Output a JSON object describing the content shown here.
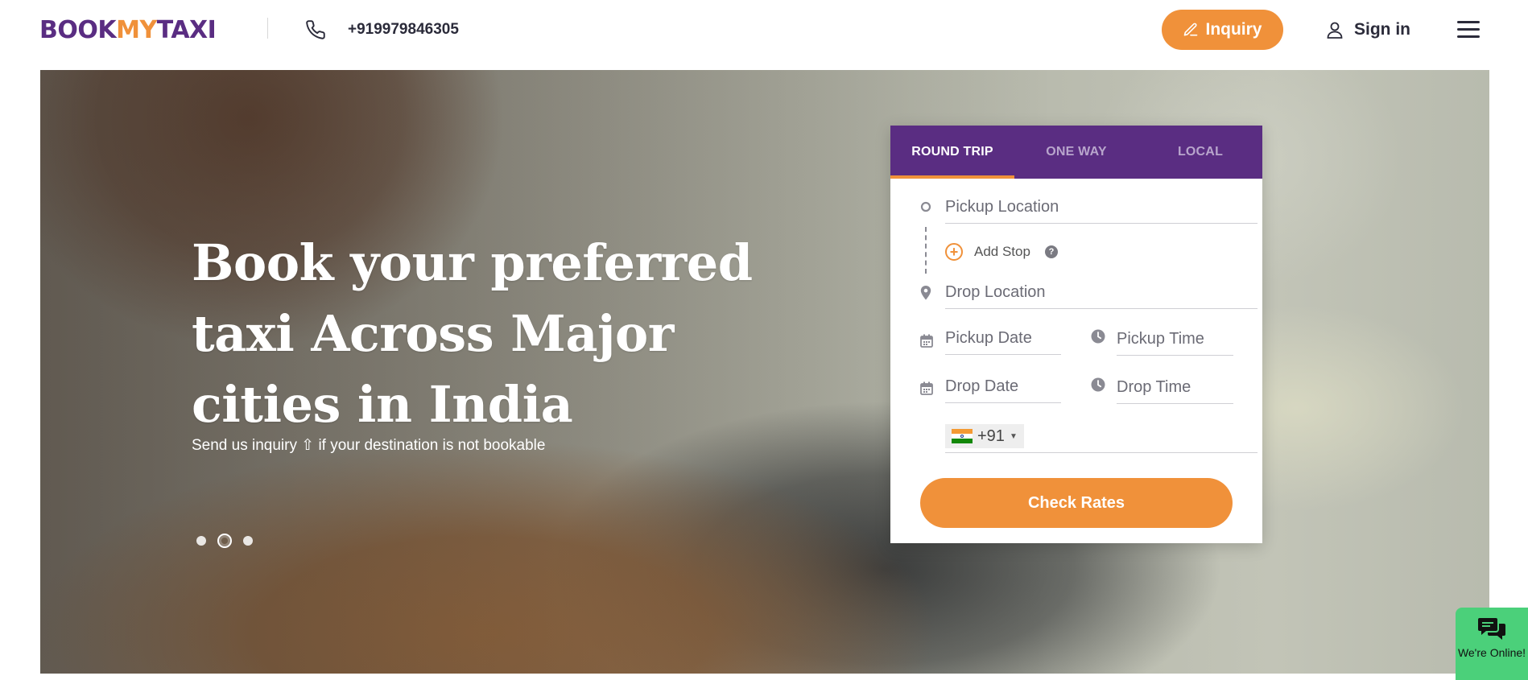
{
  "brand": {
    "part1": "BOOK",
    "part2": "MY",
    "part3": "TAXI",
    "purple": "#5a2d82",
    "orange": "#f0913a"
  },
  "header": {
    "phone_icon": "phone-icon",
    "phone_number": "+919979846305",
    "inquiry_label": "Inquiry",
    "signin_label": "Sign in",
    "menu_icon": "hamburger-menu-icon"
  },
  "hero": {
    "title": "Book your preferred taxi Across Major cities in India",
    "subtitle": "Send us inquiry ⇧ if your destination is not bookable",
    "slides": 3,
    "active_slide": 2
  },
  "booking": {
    "tabs": [
      {
        "label": "ROUND TRIP",
        "active": true
      },
      {
        "label": "ONE WAY",
        "active": false
      },
      {
        "label": "LOCAL",
        "active": false
      }
    ],
    "pickup_location": {
      "placeholder": "Pickup Location",
      "value": ""
    },
    "add_stop_label": "Add Stop",
    "drop_location": {
      "placeholder": "Drop Location",
      "value": ""
    },
    "pickup_date": {
      "placeholder": "Pickup Date",
      "value": ""
    },
    "pickup_time": {
      "placeholder": "Pickup Time",
      "value": ""
    },
    "drop_date": {
      "placeholder": "Drop Date",
      "value": ""
    },
    "drop_time": {
      "placeholder": "Drop Time",
      "value": ""
    },
    "country_code": "+91",
    "phone": {
      "value": ""
    },
    "submit_label": "Check Rates"
  },
  "chat": {
    "label": "We're Online!",
    "color": "#4bd07a"
  }
}
